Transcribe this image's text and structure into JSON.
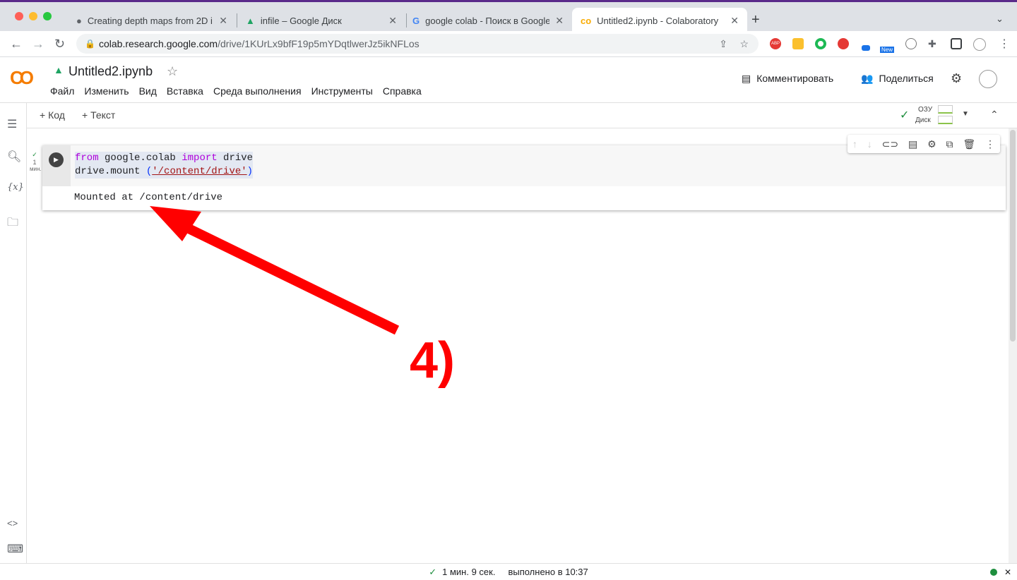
{
  "browser": {
    "tabs": [
      {
        "title": "Creating depth maps from 2D i",
        "icon": "globe-icon",
        "active": false
      },
      {
        "title": "infile – Google Диск",
        "icon": "google-drive-icon",
        "active": false
      },
      {
        "title": "google colab - Поиск в Google",
        "icon": "google-icon",
        "active": false
      },
      {
        "title": "Untitled2.ipynb - Colaboratory",
        "icon": "colab-icon",
        "active": true
      }
    ],
    "url_host": "colab.research.google.com",
    "url_path": "/drive/1KUrLx9bfF19p5mYDqtlwerJz5ikNFLos",
    "ext_badge_abp": "ABP",
    "ext_badge_new": "New"
  },
  "colab": {
    "notebook_title": "Untitled2.ipynb",
    "menu": [
      "Файл",
      "Изменить",
      "Вид",
      "Вставка",
      "Среда выполнения",
      "Инструменты",
      "Справка"
    ],
    "comment_label": "Комментировать",
    "share_label": "Поделиться",
    "add_code": "+ Код",
    "add_text": "+ Текст",
    "ram_label": "ОЗУ",
    "disk_label": "Диск",
    "sidebar_vars": "{x}"
  },
  "cell": {
    "exec_count": "1",
    "exec_unit": "мин.",
    "code_line1": {
      "kw1": "from",
      "mod": " google.colab ",
      "kw2": "import",
      "rest": " drive"
    },
    "code_line2": {
      "pre": "drive.mount ",
      "open": "(",
      "str": "'/content/drive'",
      "close": ")"
    },
    "output": "Mounted at /content/drive"
  },
  "status": {
    "duration": "1 мин. 9 сек.",
    "completed": "выполнено в 10:37"
  },
  "annotation": {
    "label": "4)",
    "color": "#ff0000"
  }
}
